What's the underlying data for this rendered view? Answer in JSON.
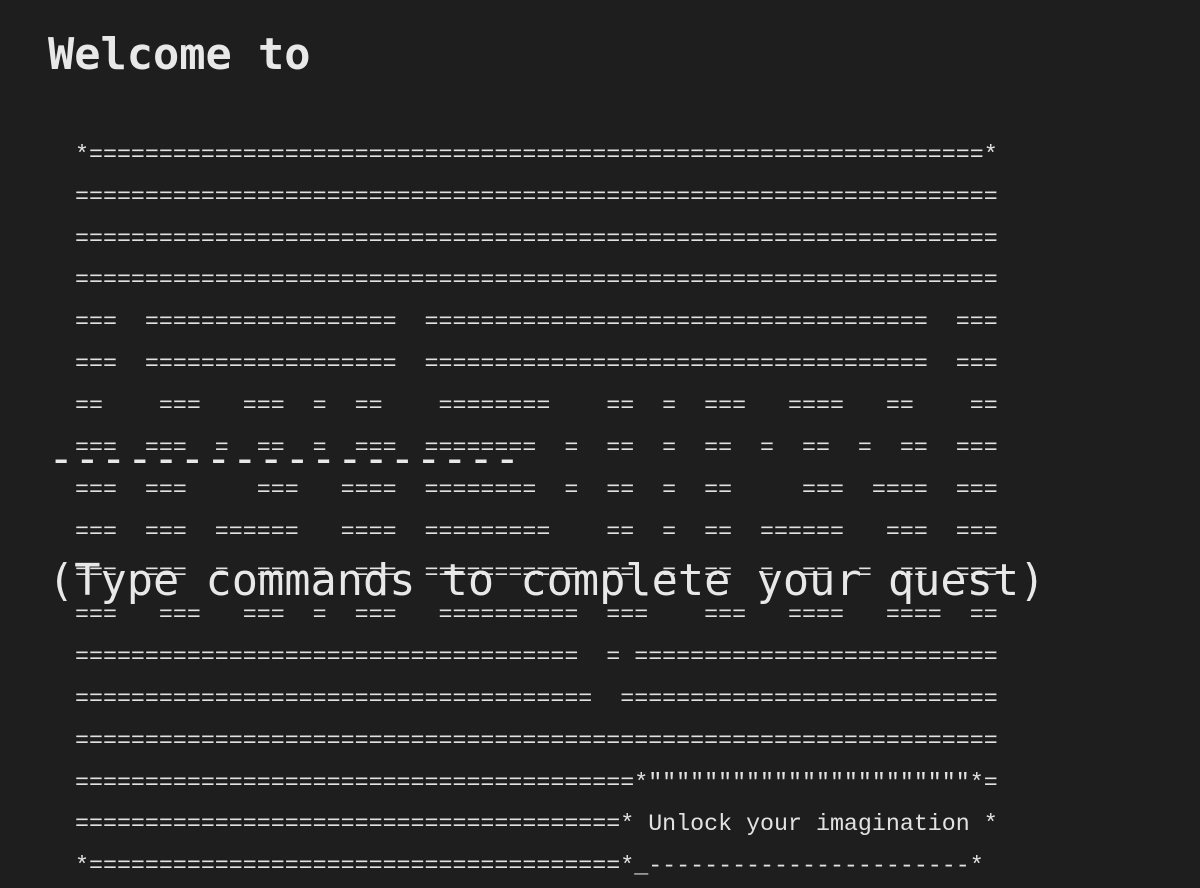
{
  "header": {
    "welcome": "Welcome to"
  },
  "banner": {
    "logo_text": "text quest",
    "rows": [
      "*================================================================*",
      "==================================================================",
      "==================================================================",
      "==================================================================",
      "===  ==================  ====================================  ===",
      "===  ==================  ====================================  ===",
      "==    ===   ===  =  ==    ========    ==  =  ===   ====   ==    ==",
      "===  ===  =  ==  =  ===  ========  =  ==  =  ==  =  ==  =  ==  ===",
      "===  ===     ===   ====  ========  =  ==  =  ==     ===  ====  ===",
      "===  ===  ======   ====  =========    ==  =  ==  ======   ===  ===",
      "===  ===  =  ==  =  ===  ===========  ==  =  ==  =  ==  =  ==  ===",
      "===   ===   ===  =  ===   ==========  ===    ===   ====   ====  ==",
      "====================================  = ==========================",
      "=====================================  ===========================",
      "==================================================================",
      "========================================*\"\"\"\"\"\"\"\"\"\"\"\"\"\"\"\"\"\"\"\"\"\"\"*="
    ],
    "tagline_prefix": "=======================================* ",
    "tagline": "Unlock your imagination",
    "tagline_suffix": " *",
    "bottom_row": "*======================================*_-----------------------*"
  },
  "divider": "------------------",
  "hint": "(Type commands to complete your quest)"
}
